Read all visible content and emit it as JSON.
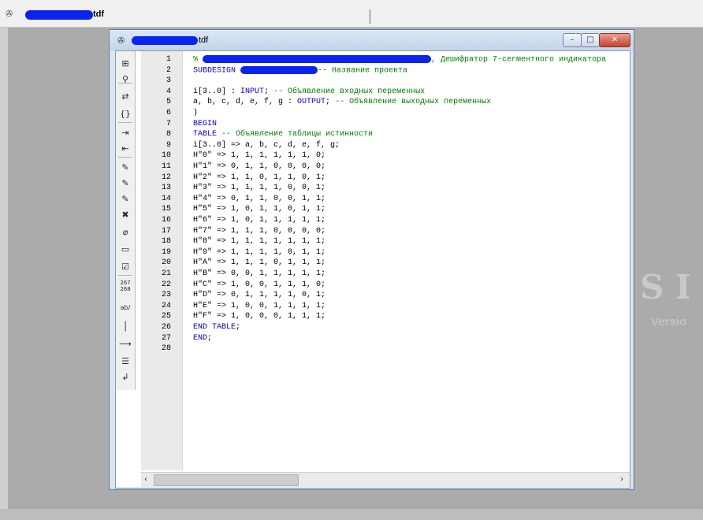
{
  "app": {
    "title_suffix": "tdf",
    "icon": "chip-icon"
  },
  "window": {
    "title_suffix": "tdf",
    "icon": "chip-icon",
    "minimize": "–",
    "maximize": "□",
    "close": "✕"
  },
  "toolbar": [
    {
      "icon": "insert-template-icon",
      "glyph": "⊞"
    },
    {
      "icon": "find-icon",
      "glyph": "⚲"
    },
    {
      "icon": "replace-icon",
      "glyph": "⇄"
    },
    {
      "icon": "braces-icon",
      "glyph": "{}"
    },
    {
      "icon": "indent-icon",
      "glyph": "⇥"
    },
    {
      "icon": "unindent-icon",
      "glyph": "⇤"
    },
    {
      "icon": "bookmark-toggle-icon",
      "glyph": "✎"
    },
    {
      "icon": "bookmark-next-icon",
      "glyph": "✎"
    },
    {
      "icon": "bookmark-prev-icon",
      "glyph": "✎"
    },
    {
      "icon": "bookmark-clear-icon",
      "glyph": "✖"
    },
    {
      "icon": "attach-icon",
      "glyph": "⌀"
    },
    {
      "icon": "scroll-icon",
      "glyph": "▭"
    },
    {
      "icon": "checkbox-icon",
      "glyph": "☑"
    },
    {
      "icon": "line-number-icon",
      "glyph": "267\n268"
    },
    {
      "icon": "text-ab-icon",
      "glyph": "ab/"
    },
    {
      "icon": "vertical-line-icon",
      "glyph": "│"
    },
    {
      "icon": "arrow-right-icon",
      "glyph": "⟶"
    },
    {
      "icon": "list-icon",
      "glyph": "☰"
    },
    {
      "icon": "wrap-icon",
      "glyph": "↲"
    }
  ],
  "code_lines": [
    {
      "n": "1",
      "parts": [
        [
          "cm",
          "% "
        ],
        [
          "redact",
          ""
        ],
        [
          "cm",
          ", Дешифратор 7-сегментного индикатора"
        ]
      ]
    },
    {
      "n": "2",
      "parts": [
        [
          "kw",
          "SUBDESIGN "
        ],
        [
          "redact",
          ""
        ],
        [
          "cm",
          "-- Название проекта"
        ]
      ]
    },
    {
      "n": "3",
      "parts": []
    },
    {
      "n": "4",
      "parts": [
        [
          "",
          "i[3..0] : "
        ],
        [
          "kw",
          "INPUT"
        ],
        [
          "",
          "; "
        ],
        [
          "cm",
          "-- Объявление входных переменных"
        ]
      ]
    },
    {
      "n": "5",
      "parts": [
        [
          "",
          "a, b, c, d, e, f, g : "
        ],
        [
          "kw",
          "OUTPUT"
        ],
        [
          "",
          "; "
        ],
        [
          "cm",
          "-- Объявление выходных переменных"
        ]
      ]
    },
    {
      "n": "6",
      "parts": [
        [
          "",
          ")"
        ]
      ]
    },
    {
      "n": "7",
      "parts": [
        [
          "kw",
          "BEGIN"
        ]
      ]
    },
    {
      "n": "8",
      "parts": [
        [
          "kw",
          "TABLE "
        ],
        [
          "cm",
          "-- Объявление таблицы истинности"
        ]
      ]
    },
    {
      "n": "9",
      "parts": [
        [
          "",
          "i[3..0] => a, b, c, d, e, f, g;"
        ]
      ]
    },
    {
      "n": "10",
      "parts": [
        [
          "",
          "H\"0\" => 1, 1, 1, 1, 1, 1, 0;"
        ]
      ]
    },
    {
      "n": "11",
      "parts": [
        [
          "",
          "H\"1\" => 0, 1, 1, 0, 0, 0, 0;"
        ]
      ]
    },
    {
      "n": "12",
      "parts": [
        [
          "",
          "H\"2\" => 1, 1, 0, 1, 1, 0, 1;"
        ]
      ]
    },
    {
      "n": "13",
      "parts": [
        [
          "",
          "H\"3\" => 1, 1, 1, 1, 0, 0, 1;"
        ]
      ]
    },
    {
      "n": "14",
      "parts": [
        [
          "",
          "H\"4\" => 0, 1, 1, 0, 0, 1, 1;"
        ]
      ]
    },
    {
      "n": "15",
      "parts": [
        [
          "",
          "H\"5\" => 1, 0, 1, 1, 0, 1, 1;"
        ]
      ]
    },
    {
      "n": "16",
      "parts": [
        [
          "",
          "H\"6\" => 1, 0, 1, 1, 1, 1, 1;"
        ]
      ]
    },
    {
      "n": "17",
      "parts": [
        [
          "",
          "H\"7\" => 1, 1, 1, 0, 0, 0, 0;"
        ]
      ]
    },
    {
      "n": "18",
      "parts": [
        [
          "",
          "H\"8\" => 1, 1, 1, 1, 1, 1, 1;"
        ]
      ]
    },
    {
      "n": "19",
      "parts": [
        [
          "",
          "H\"9\" => 1, 1, 1, 1, 0, 1, 1;"
        ]
      ]
    },
    {
      "n": "20",
      "parts": [
        [
          "",
          "H\"A\" => 1, 1, 1, 0, 1, 1, 1;"
        ]
      ]
    },
    {
      "n": "21",
      "parts": [
        [
          "",
          "H\"B\" => 0, 0, 1, 1, 1, 1, 1;"
        ]
      ]
    },
    {
      "n": "22",
      "parts": [
        [
          "",
          "H\"C\" => 1, 0, 0, 1, 1, 1, 0;"
        ]
      ]
    },
    {
      "n": "23",
      "parts": [
        [
          "",
          "H\"D\" => 0, 1, 1, 1, 1, 0, 1;"
        ]
      ]
    },
    {
      "n": "24",
      "parts": [
        [
          "",
          "H\"E\" => 1, 0, 0, 1, 1, 1, 1;"
        ]
      ]
    },
    {
      "n": "25",
      "parts": [
        [
          "",
          "H\"F\" => 1, 0, 0, 0, 1, 1, 1;"
        ]
      ]
    },
    {
      "n": "26",
      "parts": [
        [
          "kw",
          "END TABLE"
        ],
        [
          "",
          ";"
        ]
      ]
    },
    {
      "n": "27",
      "parts": [
        [
          "kw",
          "END"
        ],
        [
          "",
          ";"
        ]
      ]
    },
    {
      "n": "28",
      "parts": []
    }
  ],
  "scrollbar": {
    "left_arrow": "‹",
    "right_arrow": "›"
  },
  "background": {
    "watermark_big": "S I",
    "watermark_small": "Versio"
  }
}
